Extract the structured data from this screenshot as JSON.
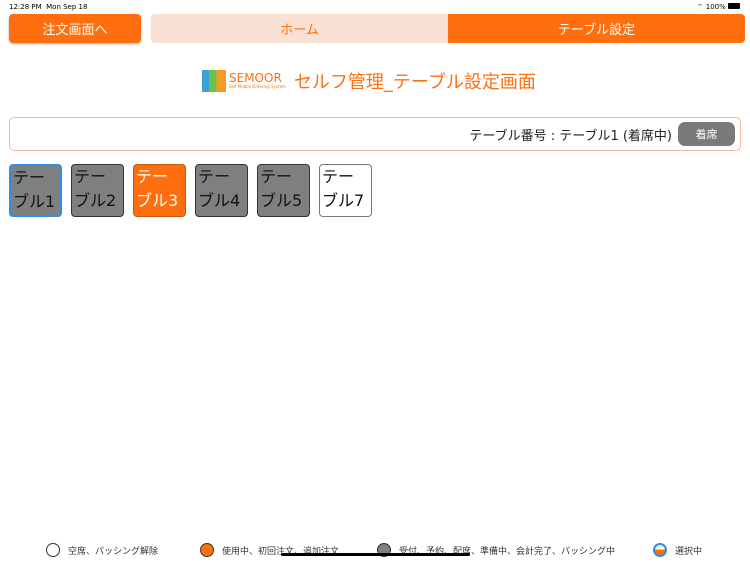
{
  "status": {
    "time": "12:28 PM",
    "date": "Mon Sep 18",
    "battery": "100%"
  },
  "header": {
    "order_button": "注文画面へ",
    "tabs": [
      {
        "label": "ホーム",
        "active": false
      },
      {
        "label": "テーブル設定",
        "active": true
      }
    ]
  },
  "title": {
    "logo": "SEMOOR",
    "logo_sub": "Self Mobile Ordering System",
    "text": "セルフ管理_テーブル設定画面"
  },
  "info": {
    "text": "テーブル番号 : テーブル1 (着席中)",
    "seat_button": "着席"
  },
  "tables": [
    {
      "line1": "テー",
      "line2": "ブル1",
      "state": "selected"
    },
    {
      "line1": "テー",
      "line2": "ブル2",
      "state": "busy"
    },
    {
      "line1": "テー",
      "line2": "ブル3",
      "state": "in-use"
    },
    {
      "line1": "テー",
      "line2": "ブル4",
      "state": "busy"
    },
    {
      "line1": "テー",
      "line2": "ブル5",
      "state": "busy"
    },
    {
      "line1": "テー",
      "line2": "ブル7",
      "state": "empty"
    }
  ],
  "legend": [
    {
      "label": "空席、パッシング解除",
      "color": "#ffffff"
    },
    {
      "label": "使用中、初回注文、追加注文",
      "color": "#ff6f0f"
    },
    {
      "label": "受付、予約、配席、準備中、会計完了、パッシング中",
      "color": "#7f7f7f"
    },
    {
      "label": "選択中",
      "color": "#2f8fe0"
    }
  ]
}
